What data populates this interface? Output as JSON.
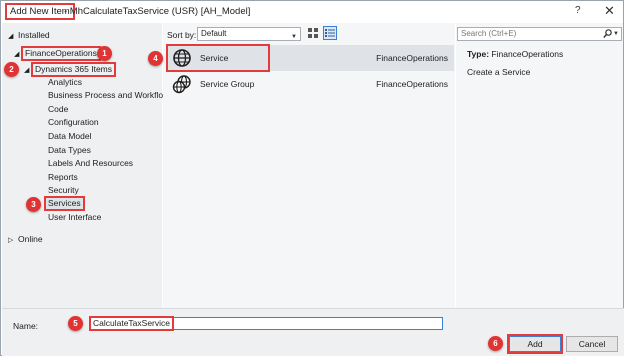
{
  "titlebar": {
    "title": "Add New Item",
    "subtitle": "- MhCalculateTaxService (USR) [AH_Model]",
    "help": "?",
    "close": "✕"
  },
  "tree": {
    "installed": "Installed",
    "finance_operations": "FinanceOperations",
    "dynamics_items": "Dynamics 365 Items",
    "children": [
      "Analytics",
      "Business Process and Workflow",
      "Code",
      "Configuration",
      "Data Model",
      "Data Types",
      "Labels And Resources",
      "Reports",
      "Security",
      "Services",
      "User Interface"
    ],
    "online": "Online"
  },
  "sort": {
    "label": "Sort by:",
    "value": "Default"
  },
  "list": [
    {
      "name": "Service",
      "category": "FinanceOperations",
      "icon": "globe-icon"
    },
    {
      "name": "Service Group",
      "category": "FinanceOperations",
      "icon": "globe-group-icon"
    }
  ],
  "search": {
    "placeholder": "Search (Ctrl+E)"
  },
  "details": {
    "type_label": "Type:",
    "type_value": "FinanceOperations",
    "description": "Create a Service"
  },
  "name_field": {
    "label": "Name:",
    "value": "CalculateTaxService"
  },
  "buttons": {
    "add": "Add",
    "cancel": "Cancel"
  },
  "badges": [
    "1",
    "2",
    "3",
    "4",
    "5",
    "6"
  ],
  "colors": {
    "callout_red": "#e03434",
    "selection_blue": "#3c7fd4"
  }
}
